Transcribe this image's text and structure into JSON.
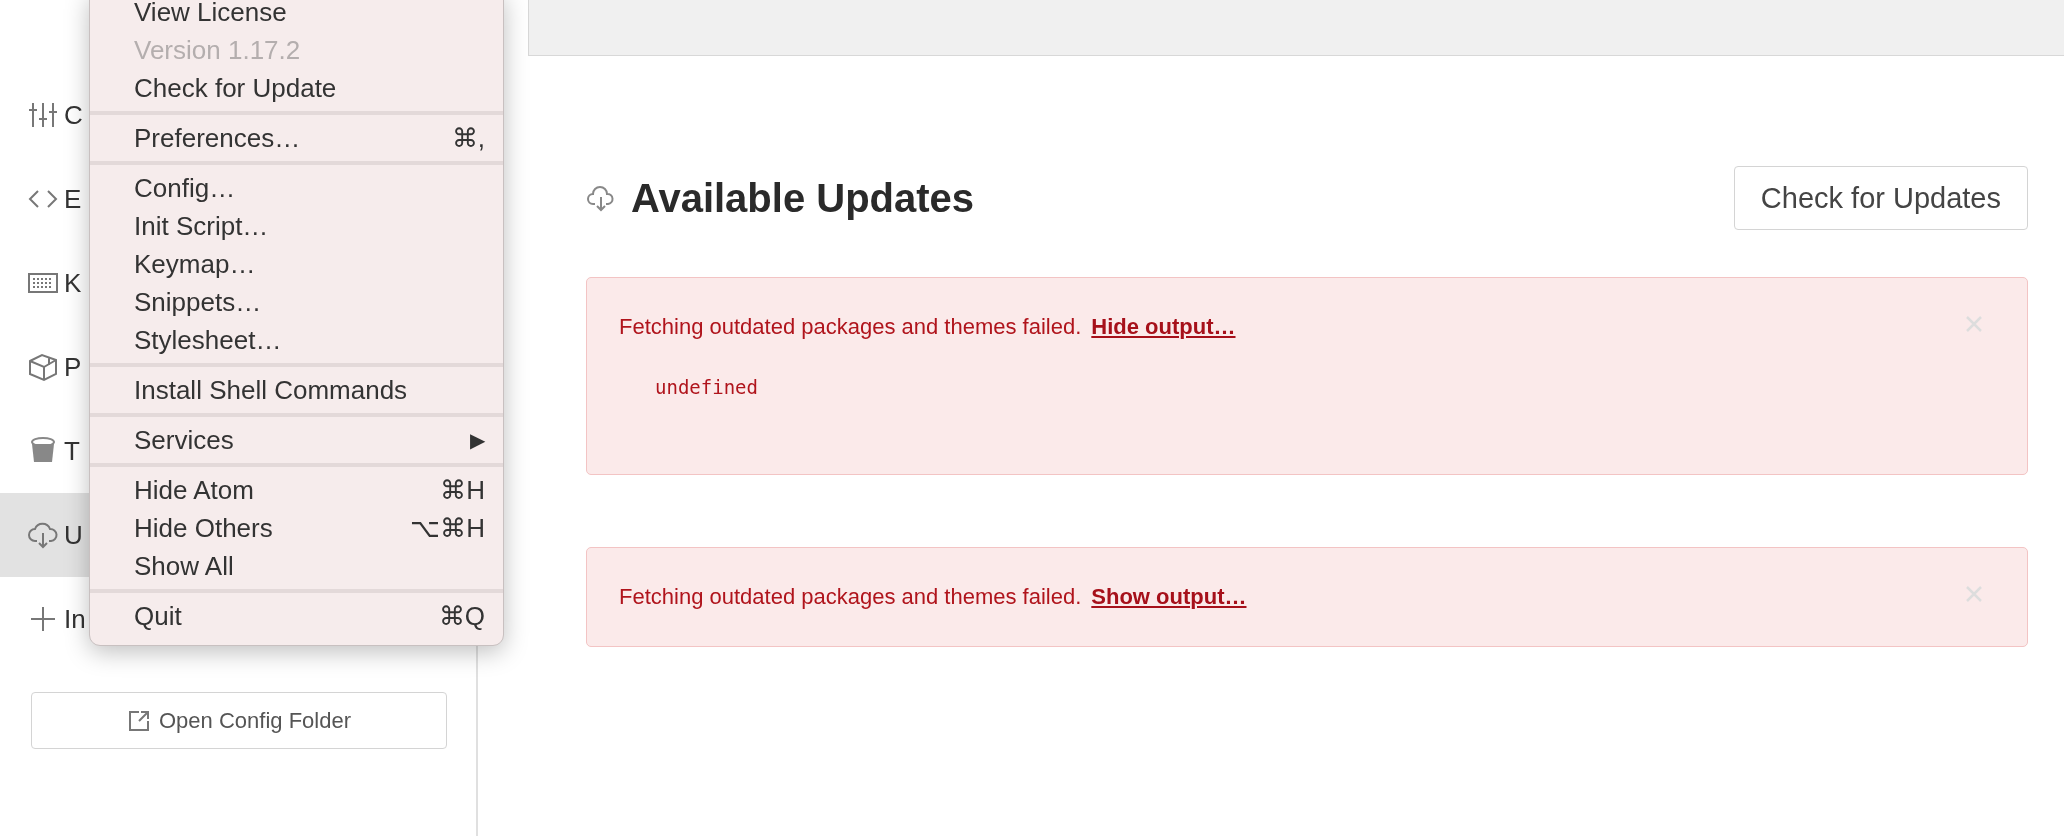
{
  "sidebar": {
    "items": [
      {
        "label": "C",
        "selected": false
      },
      {
        "label": "E",
        "selected": false
      },
      {
        "label": "K",
        "selected": false
      },
      {
        "label": "P",
        "selected": false
      },
      {
        "label": "T",
        "selected": false
      },
      {
        "label": "U",
        "selected": true
      },
      {
        "label": "In",
        "selected": false
      }
    ],
    "open_config_button": "Open Config Folder"
  },
  "main": {
    "heading": "Available Updates",
    "check_button": "Check for Updates",
    "alerts": [
      {
        "message": "Fetching outdated packages and themes failed.",
        "link": "Hide output…",
        "output": "undefined"
      },
      {
        "message": "Fetching outdated packages and themes failed.",
        "link": "Show output…"
      }
    ]
  },
  "app_menu": {
    "items": [
      {
        "kind": "item",
        "label": "View License",
        "disabled": false
      },
      {
        "kind": "item",
        "label": "Version 1.17.2",
        "disabled": true
      },
      {
        "kind": "item",
        "label": "Check for Update",
        "disabled": false
      },
      {
        "kind": "separator"
      },
      {
        "kind": "item",
        "label": "Preferences…",
        "disabled": false,
        "shortcut": "⌘,"
      },
      {
        "kind": "separator"
      },
      {
        "kind": "item",
        "label": "Config…",
        "disabled": false
      },
      {
        "kind": "item",
        "label": "Init Script…",
        "disabled": false
      },
      {
        "kind": "item",
        "label": "Keymap…",
        "disabled": false
      },
      {
        "kind": "item",
        "label": "Snippets…",
        "disabled": false
      },
      {
        "kind": "item",
        "label": "Stylesheet…",
        "disabled": false
      },
      {
        "kind": "separator"
      },
      {
        "kind": "item",
        "label": "Install Shell Commands",
        "disabled": false
      },
      {
        "kind": "separator"
      },
      {
        "kind": "item",
        "label": "Services",
        "disabled": false,
        "submenu_arrow": "▶"
      },
      {
        "kind": "separator"
      },
      {
        "kind": "item",
        "label": "Hide Atom",
        "disabled": false,
        "shortcut": "⌘H"
      },
      {
        "kind": "item",
        "label": "Hide Others",
        "disabled": false,
        "shortcut": "⌥⌘H"
      },
      {
        "kind": "item",
        "label": "Show All",
        "disabled": false
      },
      {
        "kind": "separator"
      },
      {
        "kind": "item",
        "label": "Quit",
        "disabled": false,
        "shortcut": "⌘Q"
      }
    ]
  }
}
